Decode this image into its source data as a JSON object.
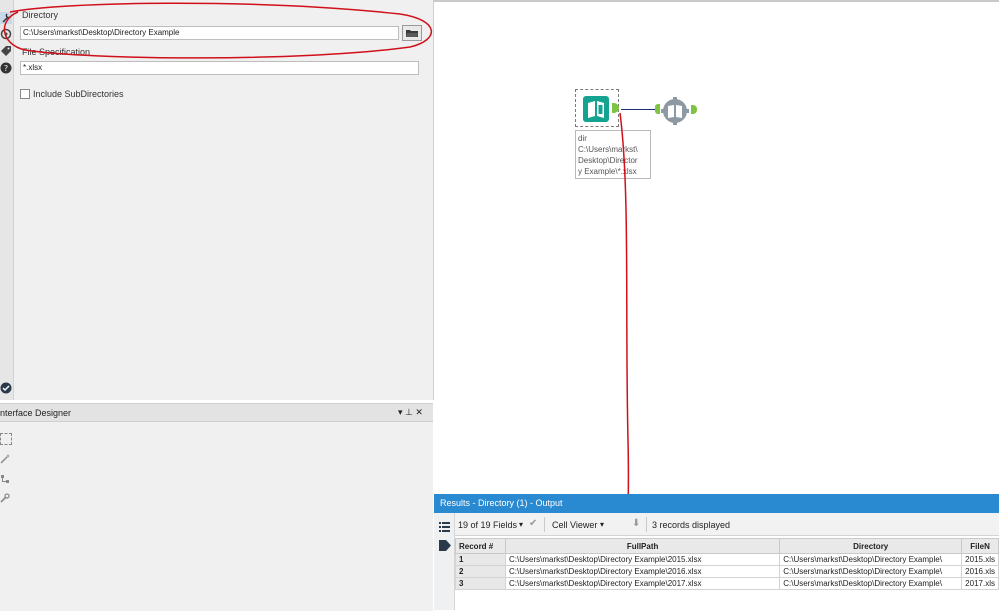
{
  "config": {
    "directory_label": "Directory",
    "directory_value": "C:\\Users\\markst\\Desktop\\Directory Example",
    "file_spec_label": "File Specification",
    "file_spec_value": "*.xlsx",
    "include_subdirs_label": "Include SubDirectories",
    "include_subdirs_checked": false
  },
  "designer": {
    "title": "nterface Designer",
    "pin_glyph": "▾ ⊥ ✕"
  },
  "canvas": {
    "tool_annotation_lines": [
      "dir",
      "C:\\Users\\markst\\",
      "Desktop\\Director",
      "y Example\\*.xlsx"
    ]
  },
  "results": {
    "title": "Results - Directory (1) - Output",
    "fields_selector": "19 of 19 Fields",
    "viewer_selector": "Cell Viewer",
    "records_displayed": "3 records displayed",
    "columns": [
      "Record #",
      "FullPath",
      "Directory",
      "FileN"
    ],
    "rows": [
      [
        "1",
        "C:\\Users\\markst\\Desktop\\Directory Example\\2015.xlsx",
        "C:\\Users\\markst\\Desktop\\Directory Example\\",
        "2015.xls"
      ],
      [
        "2",
        "C:\\Users\\markst\\Desktop\\Directory Example\\2016.xlsx",
        "C:\\Users\\markst\\Desktop\\Directory Example\\",
        "2016.xls"
      ],
      [
        "3",
        "C:\\Users\\markst\\Desktop\\Directory Example\\2017.xlsx",
        "C:\\Users\\markst\\Desktop\\Directory Example\\",
        "2017.xls"
      ]
    ]
  },
  "colors": {
    "accent_blue": "#2a8ad1",
    "tool_teal": "#14a391",
    "annotation_red": "#d0101a",
    "anchor_green": "#7cc442"
  }
}
